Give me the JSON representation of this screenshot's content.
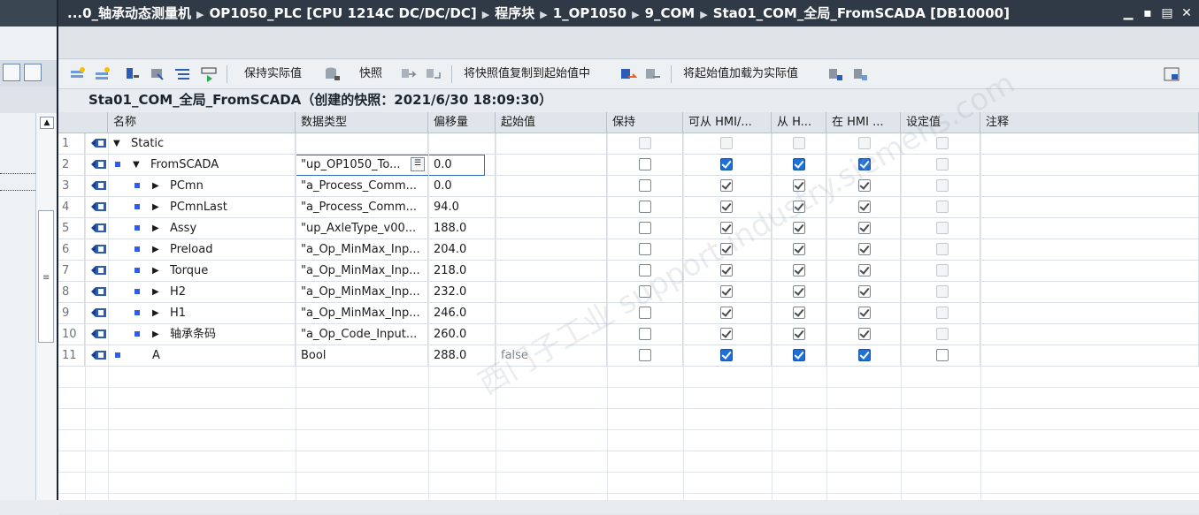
{
  "titlebar": {
    "path": [
      "...0_轴承动态测量机",
      "OP1050_PLC [CPU 1214C DC/DC/DC]",
      "程序块",
      "1_OP1050",
      "9_COM",
      "Sta01_COM_全局_FromSCADA [DB10000]"
    ],
    "controls": [
      "minimize-icon",
      "restore-icon",
      "maximize-icon",
      "close-icon"
    ]
  },
  "toolbar": {
    "keep_actual": "保持实际值",
    "snapshot": "快照",
    "copy_snapshot": "将快照值复制到起始值中",
    "load_start": "将起始值加载为实际值"
  },
  "snapshot_title": "Sta01_COM_全局_FromSCADA（创建的快照：2021/6/30 18:09:30）",
  "table": {
    "headers": [
      "名称",
      "数据类型",
      "偏移量",
      "起始值",
      "保持",
      "可从 HMI/...",
      "从 H...",
      "在 HMI ...",
      "设定值",
      "注释"
    ],
    "rows": [
      {
        "num": "1",
        "name": "Static",
        "type": "",
        "offset": "",
        "start": "",
        "level": 0,
        "caret": "down",
        "sq": false,
        "keep": "dis",
        "hmi1": "dis",
        "hmi2": "dis",
        "hmi3": "dis",
        "set": "dis"
      },
      {
        "num": "2",
        "name": "FromSCADA",
        "type": "\"up_OP1050_To...",
        "offset": "0.0",
        "start": "",
        "level": 1,
        "caret": "down",
        "sq": true,
        "keep": "off",
        "hmi1": "blue",
        "hmi2": "blue",
        "hmi3": "blue",
        "set": "dis",
        "selected": true
      },
      {
        "num": "3",
        "name": "PCmn",
        "type": "\"a_Process_Comm...",
        "offset": "0.0",
        "start": "",
        "level": 2,
        "caret": "right",
        "sq": true,
        "keep": "off",
        "hmi1": "on",
        "hmi2": "on",
        "hmi3": "on",
        "set": "dis"
      },
      {
        "num": "4",
        "name": "PCmnLast",
        "type": "\"a_Process_Comm...",
        "offset": "94.0",
        "start": "",
        "level": 2,
        "caret": "right",
        "sq": true,
        "keep": "off",
        "hmi1": "on",
        "hmi2": "on",
        "hmi3": "on",
        "set": "dis"
      },
      {
        "num": "5",
        "name": "Assy",
        "type": "\"up_AxleType_v00...",
        "offset": "188.0",
        "start": "",
        "level": 2,
        "caret": "right",
        "sq": true,
        "keep": "off",
        "hmi1": "on",
        "hmi2": "on",
        "hmi3": "on",
        "set": "dis"
      },
      {
        "num": "6",
        "name": "Preload",
        "type": "\"a_Op_MinMax_Inp...",
        "offset": "204.0",
        "start": "",
        "level": 2,
        "caret": "right",
        "sq": true,
        "keep": "off",
        "hmi1": "on",
        "hmi2": "on",
        "hmi3": "on",
        "set": "dis"
      },
      {
        "num": "7",
        "name": "Torque",
        "type": "\"a_Op_MinMax_Inp...",
        "offset": "218.0",
        "start": "",
        "level": 2,
        "caret": "right",
        "sq": true,
        "keep": "off",
        "hmi1": "on",
        "hmi2": "on",
        "hmi3": "on",
        "set": "dis"
      },
      {
        "num": "8",
        "name": "H2",
        "type": "\"a_Op_MinMax_Inp...",
        "offset": "232.0",
        "start": "",
        "level": 2,
        "caret": "right",
        "sq": true,
        "keep": "off",
        "hmi1": "on",
        "hmi2": "on",
        "hmi3": "on",
        "set": "dis"
      },
      {
        "num": "9",
        "name": "H1",
        "type": "\"a_Op_MinMax_Inp...",
        "offset": "246.0",
        "start": "",
        "level": 2,
        "caret": "right",
        "sq": true,
        "keep": "off",
        "hmi1": "on",
        "hmi2": "on",
        "hmi3": "on",
        "set": "dis"
      },
      {
        "num": "10",
        "name": "轴承条码",
        "type": "\"a_Op_Code_Input...",
        "offset": "260.0",
        "start": "",
        "level": 2,
        "caret": "right",
        "sq": true,
        "keep": "off",
        "hmi1": "on",
        "hmi2": "on",
        "hmi3": "on",
        "set": "dis"
      },
      {
        "num": "11",
        "name": "A",
        "type": "Bool",
        "offset": "288.0",
        "start": "false",
        "level": 1,
        "caret": "none",
        "sq": true,
        "keep": "off",
        "hmi1": "blue",
        "hmi2": "blue",
        "hmi3": "blue",
        "set": "off"
      }
    ]
  },
  "watermark": "西门子工业 support.industry.siemens.com"
}
